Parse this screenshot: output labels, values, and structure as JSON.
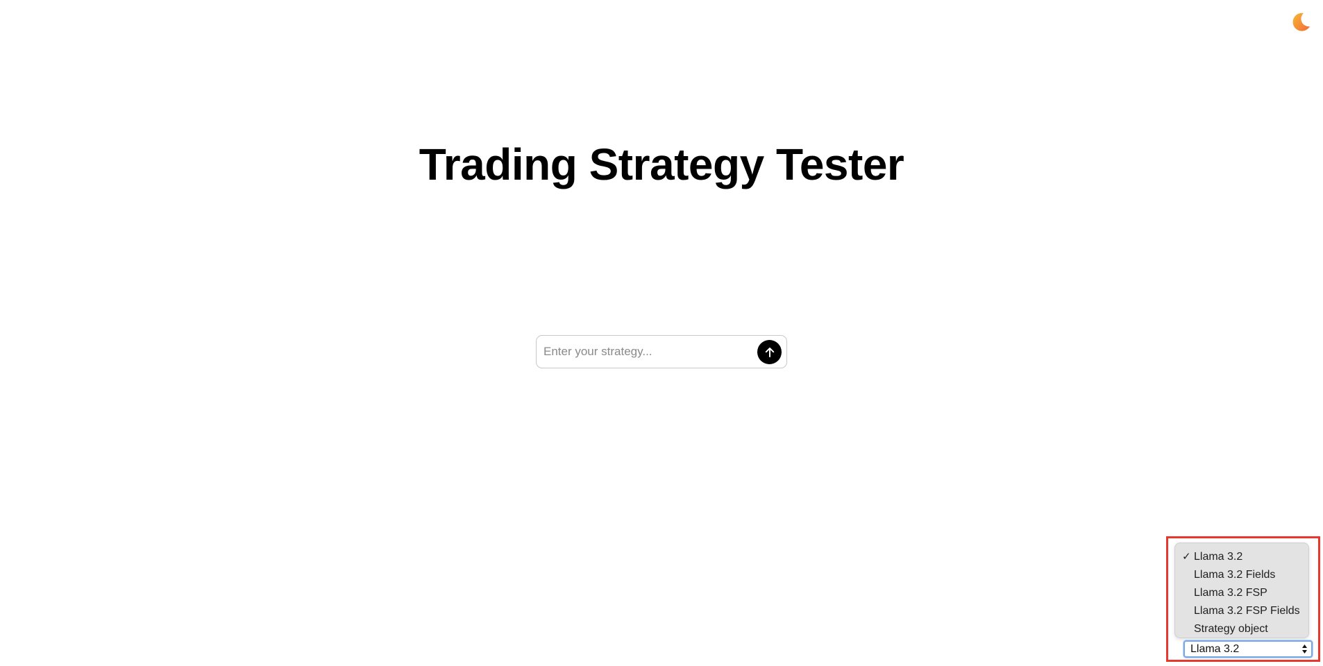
{
  "header": {
    "theme_toggle_icon": "moon-icon",
    "theme_toggle_colors": [
      "#f5a623",
      "#f26b3a"
    ]
  },
  "main": {
    "title": "Trading Strategy Tester",
    "strategy_input": {
      "value": "",
      "placeholder": "Enter your strategy..."
    },
    "send_icon": "arrow-up-icon"
  },
  "model_selector": {
    "selected": "Llama 3.2",
    "options": [
      {
        "label": "Llama 3.2",
        "checked": true
      },
      {
        "label": "Llama 3.2 Fields",
        "checked": false
      },
      {
        "label": "Llama 3.2 FSP",
        "checked": false
      },
      {
        "label": "Llama 3.2 FSP Fields",
        "checked": false
      },
      {
        "label": "Strategy object",
        "checked": false
      }
    ],
    "checkmark": "✓"
  },
  "colors": {
    "highlight": "#e8372c",
    "button": "#000000",
    "focus_ring": "#7aa7e6"
  }
}
